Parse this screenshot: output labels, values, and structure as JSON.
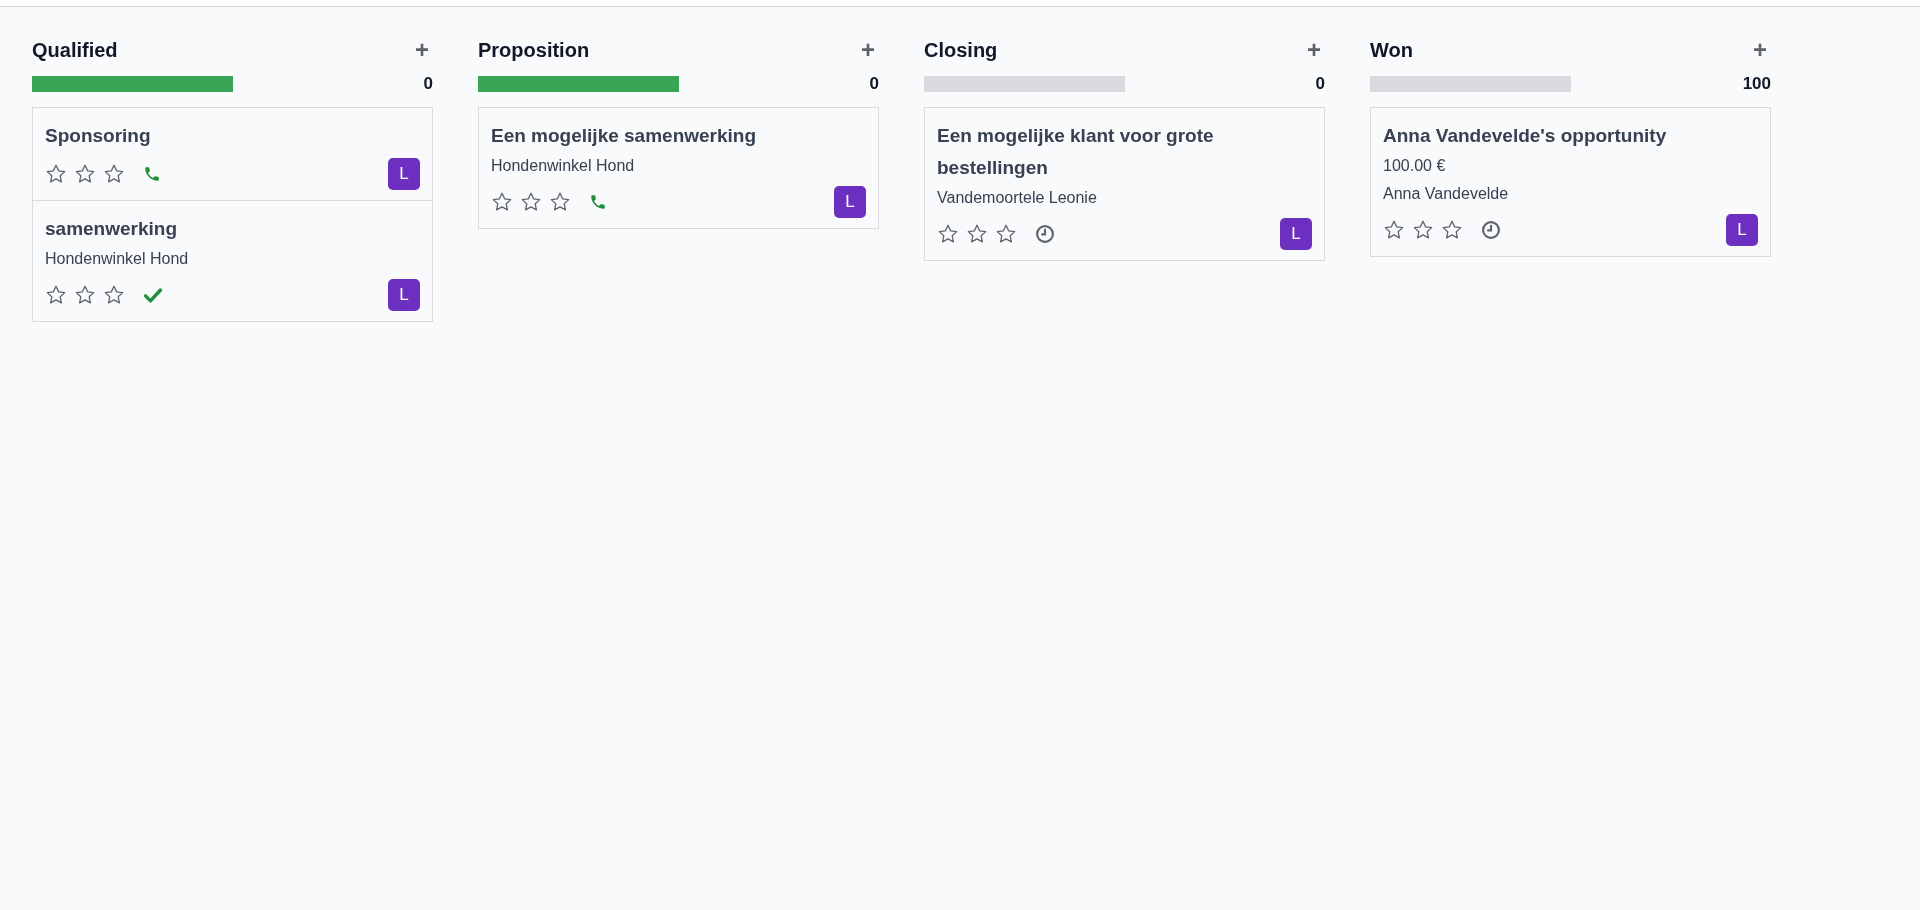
{
  "columns": [
    {
      "title": "Qualified",
      "add": "+",
      "progress": {
        "level": 1
      },
      "total": "0",
      "cards": [
        {
          "title": "Sponsoring",
          "stars": 0,
          "activity": {
            "kind": "phone"
          },
          "avatar": "L"
        },
        {
          "title": "samenwerking",
          "lines": [
            "Hondenwinkel Hond"
          ],
          "stars": 0,
          "activity": {
            "kind": "done"
          },
          "avatar": "L"
        }
      ]
    },
    {
      "title": "Proposition",
      "add": "+",
      "progress": {
        "level": 1
      },
      "total": "0",
      "cards": [
        {
          "title": "Een mogelijke samenwerking",
          "lines": [
            "Hondenwinkel Hond"
          ],
          "stars": 0,
          "activity": {
            "kind": "phone"
          },
          "avatar": "L"
        }
      ]
    },
    {
      "title": "Closing",
      "add": "+",
      "progress": {
        "level": 0
      },
      "total": "0",
      "cards": [
        {
          "title": "Een mogelijke klant voor grote bestellingen",
          "lines": [
            "Vandemoortele Leonie"
          ],
          "stars": 0,
          "activity": {
            "kind": "clock"
          },
          "avatar": "L"
        }
      ]
    },
    {
      "title": "Won",
      "add": "+",
      "progress": {
        "level": 0
      },
      "total": "100",
      "cards": [
        {
          "title": "Anna Vandevelde's opportunity",
          "lines": [
            "100.00 €",
            "Anna Vandevelde"
          ],
          "stars": 0,
          "activity": {
            "kind": "clock"
          },
          "avatar": "L"
        }
      ]
    }
  ]
}
